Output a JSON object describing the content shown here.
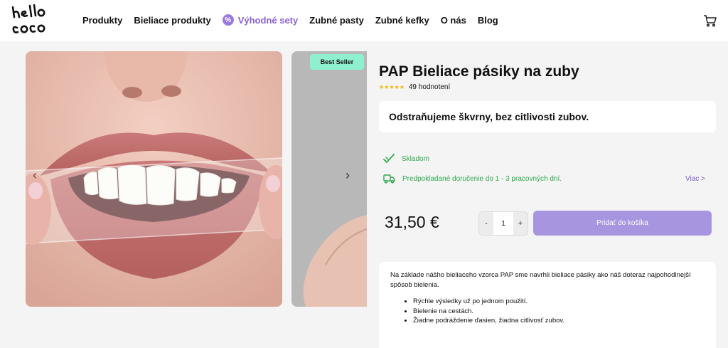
{
  "header": {
    "logo_text": "hello coco",
    "nav": [
      {
        "label": "Produkty"
      },
      {
        "label": "Bieliace produkty"
      },
      {
        "label": "Výhodné sety",
        "icon": "percent-icon",
        "accent": "#8a63d2"
      },
      {
        "label": "Zubné pasty"
      },
      {
        "label": "Zubné kefky"
      },
      {
        "label": "O nás"
      },
      {
        "label": "Blog"
      }
    ],
    "cart_icon": "cart-icon"
  },
  "gallery": {
    "badge": "Best Seller",
    "prev_icon": "chevron-left-icon",
    "next_icon": "chevron-right-icon"
  },
  "product": {
    "title": "PAP Bieliace pásiky na zuby",
    "rating_stars": "★★★★★",
    "rating_count": "49 hodnotení",
    "tagline": "Odstraňujeme škvrny, bez citlivosti zubov.",
    "stock": "Skladom",
    "delivery": "Predpokladané doručenie do 1 - 3 pracovných dní.",
    "more_link": "Viac >",
    "price": "31,50 €",
    "quantity": "1",
    "minus": "-",
    "plus": "+",
    "add_to_cart": "Pridať do košíka",
    "description": "Na základe nášho bieliaceho vzorca PAP sme navrhli bieliace pásiky ako náš doteraz najpohodlnejší spôsob bielenia.",
    "features": [
      "Rýchle výsledky už po jednom použití.",
      "Bielenie na cestách.",
      "Žiadne podráždenie ďasien, žiadna citlivosť zubov."
    ]
  },
  "colors": {
    "accent": "#8a63d2",
    "button": "#a895e0",
    "badge": "#8ff0d0",
    "success": "#2fa84f",
    "star": "#f2b400"
  }
}
